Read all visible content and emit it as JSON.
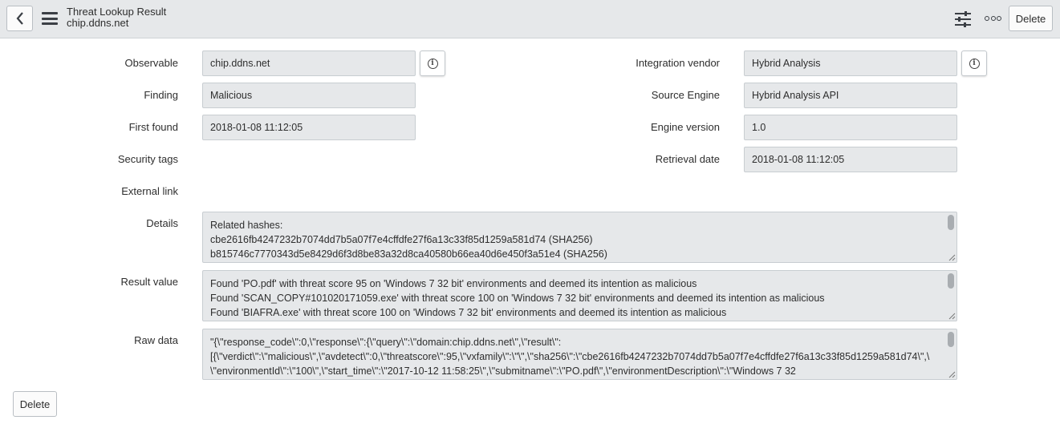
{
  "header": {
    "title": "Threat Lookup Result",
    "subtitle": "chip.ddns.net",
    "delete_label": "Delete"
  },
  "form": {
    "observable": {
      "label": "Observable",
      "value": "chip.ddns.net"
    },
    "finding": {
      "label": "Finding",
      "value": "Malicious"
    },
    "first_found": {
      "label": "First found",
      "value": "2018-01-08 11:12:05"
    },
    "security_tags": {
      "label": "Security tags"
    },
    "external_link": {
      "label": "External link"
    },
    "integration_vendor": {
      "label": "Integration vendor",
      "value": "Hybrid Analysis"
    },
    "source_engine": {
      "label": "Source Engine",
      "value": "Hybrid Analysis API"
    },
    "engine_version": {
      "label": "Engine version",
      "value": "1.0"
    },
    "retrieval_date": {
      "label": "Retrieval date",
      "value": "2018-01-08 11:12:05"
    },
    "details": {
      "label": "Details",
      "lines": [
        "Related hashes:",
        "cbe2616fb4247232b7074dd7b5a07f7e4cffdfe27f6a13c33f85d1259a581d74 (SHA256)",
        "b815746c7770343d5e8429d6f3d8be83a32d8ca40580b66ea40d6e450f3a51e4 (SHA256)"
      ]
    },
    "result_value": {
      "label": "Result value",
      "lines": [
        "Found 'PO.pdf' with threat score 95  on 'Windows 7 32 bit' environments and deemed its intention as malicious",
        "Found 'SCAN_COPY#101020171059.exe' with threat score 100  on 'Windows 7 32 bit' environments and deemed its intention as malicious",
        "Found 'BIAFRA.exe' with threat score 100  on 'Windows 7 32 bit' environments and deemed its intention as malicious"
      ]
    },
    "raw_data": {
      "label": "Raw data",
      "lines": [
        "\"{\\\"response_code\\\":0,\\\"response\\\":{\\\"query\\\":\\\"domain:chip.ddns.net\\\",\\\"result\\\":",
        "[{\\\"verdict\\\":\\\"malicious\\\",\\\"avdetect\\\":0,\\\"threatscore\\\":95,\\\"vxfamily\\\":\\\"\\\",\\\"sha256\\\":\\\"cbe2616fb4247232b7074dd7b5a07f7e4cffdfe27f6a13c33f85d1259a581d74\\\",\\",
        "\\\"environmentId\\\":\\\"100\\\",\\\"start_time\\\":\\\"2017-10-12 11:58:25\\\",\\\"submitname\\\":\\\"PO.pdf\\\",\\\"environmentDescription\\\":\\\"Windows 7 32"
      ]
    }
  },
  "footer": {
    "delete_label": "Delete"
  },
  "icons": {
    "back": "chevron-left-icon",
    "menu": "hamburger-menu-icon",
    "personalize": "sliders-icon",
    "more": "more-options-icon",
    "info": "info-icon"
  }
}
